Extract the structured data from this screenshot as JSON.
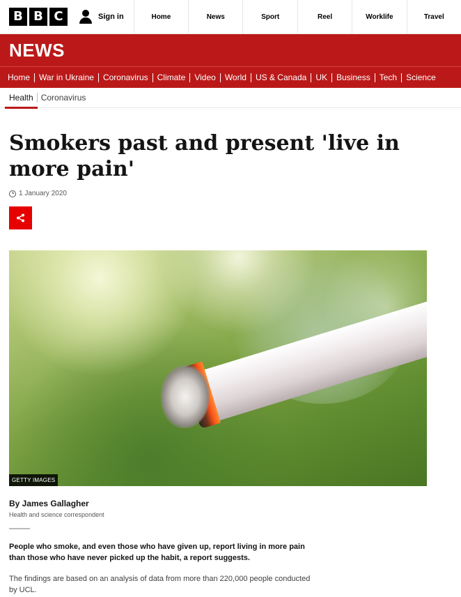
{
  "global_bar": {
    "logo_letters": [
      "B",
      "B",
      "C"
    ],
    "sign_in": "Sign in",
    "nav": [
      "Home",
      "News",
      "Sport",
      "Reel",
      "Worklife",
      "Travel"
    ]
  },
  "news": {
    "wordmark": "NEWS",
    "nav": [
      "Home",
      "War in Ukraine",
      "Coronavirus",
      "Climate",
      "Video",
      "World",
      "US & Canada",
      "UK",
      "Business",
      "Tech",
      "Science"
    ]
  },
  "sub_nav": [
    "Health",
    "Coronavirus"
  ],
  "article": {
    "title": "Smokers past and present 'live in more pain'",
    "date": "1 January 2020",
    "image_credit": "GETTY IMAGES",
    "byline_name": "By James Gallagher",
    "byline_role": "Health and science correspondent",
    "intro": "People who smoke, and even those who have given up, report living in more pain than those who have never picked up the habit, a report suggests.",
    "paragraph": "The findings are based on an analysis of data from more than 220,000 people conducted by UCL."
  },
  "colors": {
    "news_red": "#bb1919",
    "share_red": "#e60000"
  },
  "icons": {
    "user": "user-icon",
    "clock": "clock-icon",
    "share": "share-icon"
  }
}
